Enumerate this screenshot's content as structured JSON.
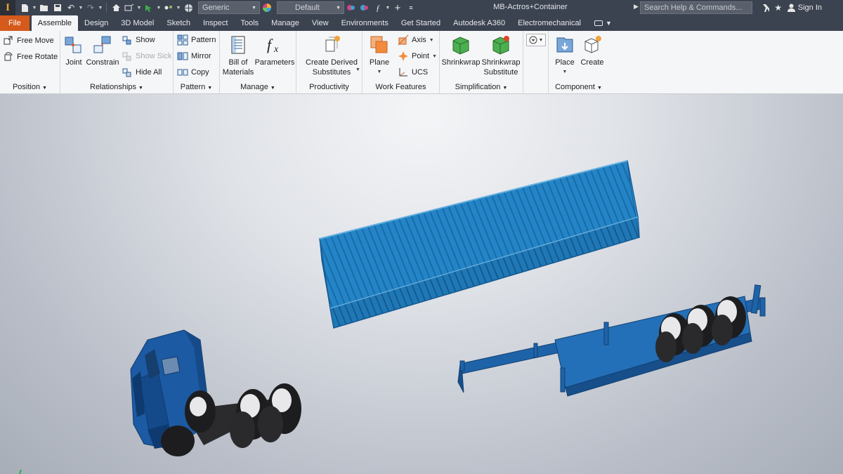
{
  "app": {
    "window_title": "MB-Actros+Container",
    "logo_letter": "I",
    "search_placeholder": "Search Help & Commands...",
    "signin_label": "Sign In"
  },
  "quick_access": {
    "appearance_value": "Generic",
    "style_value": "Default",
    "icons": [
      "new-icon",
      "open-icon",
      "save-icon",
      "undo-icon",
      "redo-icon",
      "home-icon",
      "measure-icon",
      "select-icon",
      "appearance-icon",
      "parameters-icon",
      "add-icon"
    ]
  },
  "tabs": [
    {
      "label": "File"
    },
    {
      "label": "Assemble"
    },
    {
      "label": "Design"
    },
    {
      "label": "3D Model"
    },
    {
      "label": "Sketch"
    },
    {
      "label": "Inspect"
    },
    {
      "label": "Tools"
    },
    {
      "label": "Manage"
    },
    {
      "label": "View"
    },
    {
      "label": "Environments"
    },
    {
      "label": "Get Started"
    },
    {
      "label": "Autodesk A360"
    },
    {
      "label": "Electromechanical"
    }
  ],
  "active_tab": "Assemble",
  "ribbon": {
    "position": {
      "label": "Position",
      "free_move": "Free Move",
      "free_rotate": "Free Rotate"
    },
    "relationships": {
      "label": "Relationships",
      "joint": "Joint",
      "constrain": "Constrain",
      "show": "Show",
      "show_sick": "Show Sick",
      "hide_all": "Hide All"
    },
    "pattern": {
      "label": "Pattern",
      "pattern": "Pattern",
      "mirror": "Mirror",
      "copy": "Copy"
    },
    "manage": {
      "label": "Manage",
      "bom_line1": "Bill of",
      "bom_line2": "Materials",
      "parameters": "Parameters"
    },
    "productivity": {
      "label": "Productivity",
      "derived_line1": "Create Derived",
      "derived_line2": "Substitutes"
    },
    "work_features": {
      "label": "Work Features",
      "plane": "Plane",
      "axis": "Axis",
      "point": "Point",
      "ucs": "UCS"
    },
    "simplification": {
      "label": "Simplification",
      "shrinkwrap": "Shrinkwrap",
      "shrinkwrap_sub_line1": "Shrinkwrap",
      "shrinkwrap_sub_line2": "Substitute"
    },
    "component": {
      "label": "Component",
      "place": "Place",
      "create": "Create"
    }
  },
  "colors": {
    "file_tab": "#d55a1c",
    "container_blue": "#1f7fc0",
    "truck_blue": "#1c5aa3",
    "chassis_blue": "#1e63a8"
  }
}
